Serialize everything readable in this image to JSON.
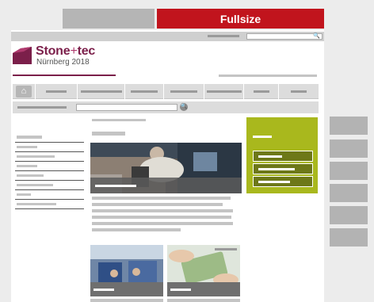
{
  "tabs": {
    "fullsize_label": "Fullsize"
  },
  "header": {
    "logo_name_start": "Stone",
    "logo_plus": "+",
    "logo_name_end": "tec",
    "logo_subtitle": "Nürnberg 2018"
  },
  "icons": {
    "home": "home-icon",
    "search": "search-icon"
  },
  "colors": {
    "fullsize_tab": "#c1141d",
    "brand": "#7b1f4a",
    "green_box": "#a9b81d"
  }
}
